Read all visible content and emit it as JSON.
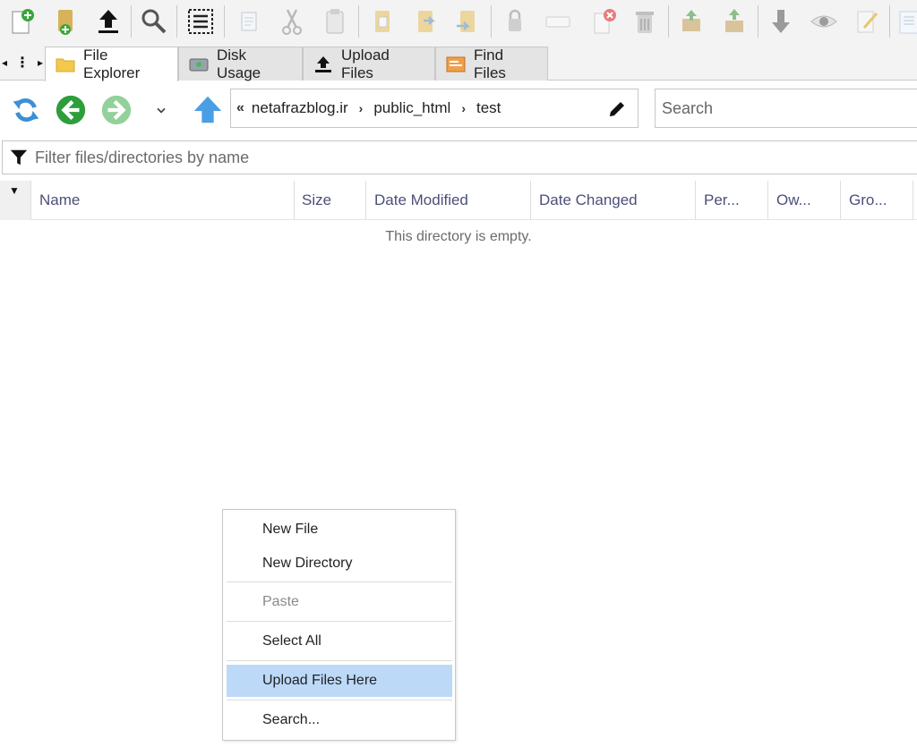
{
  "toolbar": {
    "buttons": [
      {
        "name": "new-file-icon"
      },
      {
        "name": "new-folder-icon"
      },
      {
        "name": "upload-icon"
      },
      {
        "name": "search-icon"
      },
      {
        "name": "select-all-icon"
      },
      {
        "name": "copy-icon"
      },
      {
        "name": "cut-icon"
      },
      {
        "name": "paste-icon"
      },
      {
        "name": "copy-to-folder-icon"
      },
      {
        "name": "move-to-folder-icon"
      },
      {
        "name": "rename-folder-icon"
      },
      {
        "name": "permissions-icon"
      },
      {
        "name": "rename-icon"
      },
      {
        "name": "delete-file-icon"
      },
      {
        "name": "trash-icon"
      },
      {
        "name": "compress-icon"
      },
      {
        "name": "extract-icon"
      },
      {
        "name": "download-icon"
      },
      {
        "name": "view-icon"
      },
      {
        "name": "edit-icon"
      },
      {
        "name": "html-editor-icon"
      }
    ]
  },
  "tabs": [
    {
      "label": "File Explorer",
      "icon": "folder-icon",
      "active": true
    },
    {
      "label": "Disk Usage",
      "icon": "disk-icon",
      "active": false
    },
    {
      "label": "Upload Files",
      "icon": "upload-icon",
      "active": false
    },
    {
      "label": "Find Files",
      "icon": "find-files-icon",
      "active": false
    }
  ],
  "nav": {
    "breadcrumb": [
      "netafrazblog.ir",
      "public_html",
      "test"
    ],
    "search_placeholder": "Search"
  },
  "filter": {
    "placeholder": "Filter files/directories by name"
  },
  "columns": [
    "Name",
    "Size",
    "Date Modified",
    "Date Changed",
    "Per...",
    "Ow...",
    "Gro..."
  ],
  "empty_message": "This directory is empty.",
  "context_menu": {
    "items": [
      {
        "label": "New File",
        "enabled": true,
        "highlighted": false
      },
      {
        "label": "New Directory",
        "enabled": true,
        "highlighted": false
      },
      {
        "label": "Paste",
        "enabled": false,
        "highlighted": false
      },
      {
        "label": "Select All",
        "enabled": true,
        "highlighted": false
      },
      {
        "label": "Upload Files Here",
        "enabled": true,
        "highlighted": true
      },
      {
        "label": "Search...",
        "enabled": true,
        "highlighted": false
      }
    ]
  },
  "colors": {
    "accent_highlight": "#bcd9f8",
    "header_text": "#4b4f79",
    "nav_green": "#2e9e3a",
    "nav_blue": "#3d8fd6"
  }
}
